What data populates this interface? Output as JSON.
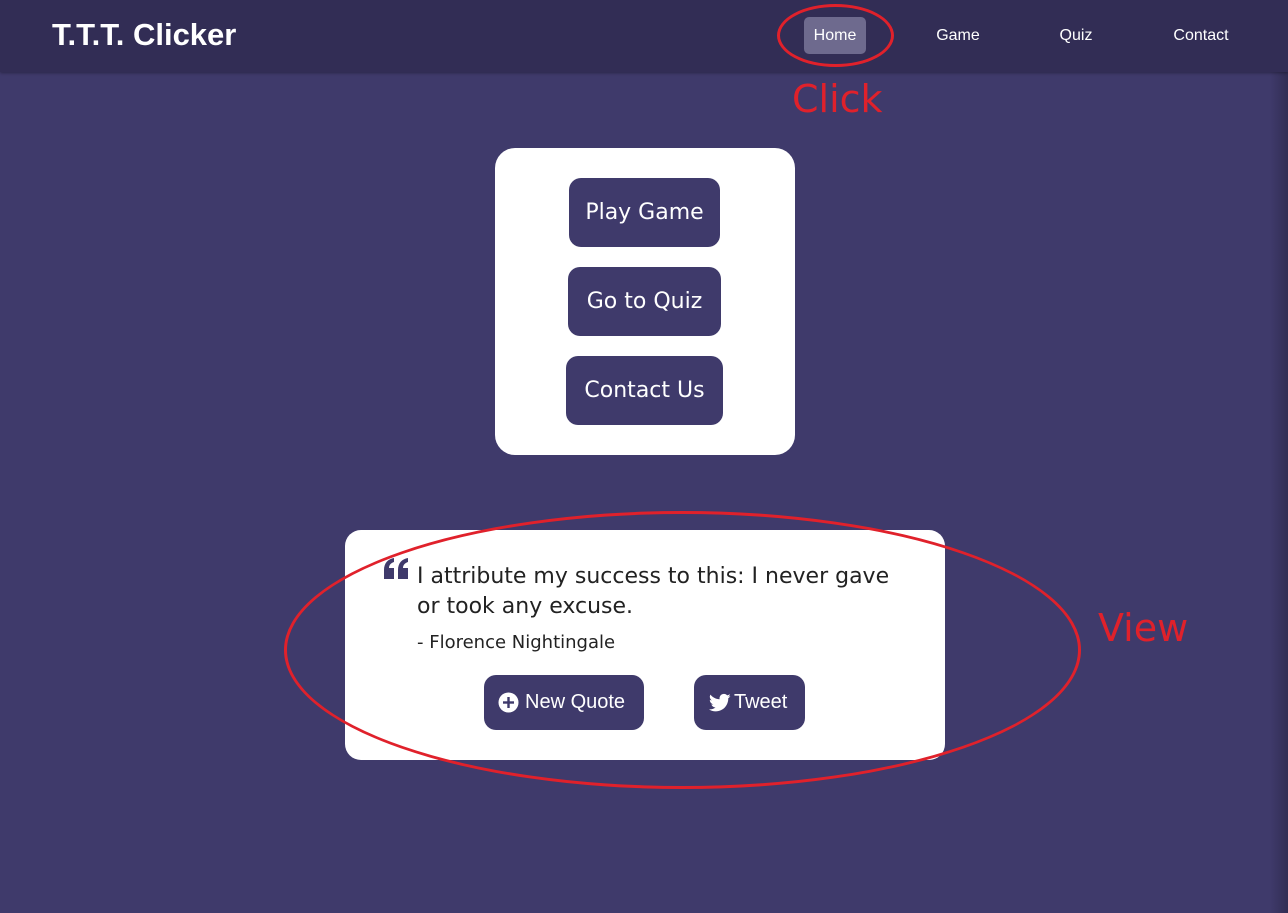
{
  "header": {
    "brand": "T.T.T. Clicker",
    "nav": [
      {
        "label": "Home",
        "active": true
      },
      {
        "label": "Game",
        "active": false
      },
      {
        "label": "Quiz",
        "active": false
      },
      {
        "label": "Contact",
        "active": false
      }
    ]
  },
  "menu": {
    "buttons": [
      {
        "label": "Play Game"
      },
      {
        "label": "Go to Quiz"
      },
      {
        "label": "Contact Us"
      }
    ]
  },
  "quote": {
    "icon": "quote-left-icon",
    "text": "I attribute my success to this: I never gave or took any excuse.",
    "author": "- Florence Nightingale",
    "new_quote_label": "New Quote",
    "new_quote_icon": "plus-circle-icon",
    "tweet_label": "Tweet",
    "tweet_icon": "twitter-bird-icon"
  },
  "annotations": {
    "click_label": "Click",
    "view_label": "View",
    "color": "#e0212b"
  },
  "colors": {
    "page_background": "#3f3a6b",
    "navbar_background": "#322d55",
    "active_nav_background": "#6e6a8e",
    "button_background": "#3f3a6b",
    "card_background": "#ffffff"
  }
}
